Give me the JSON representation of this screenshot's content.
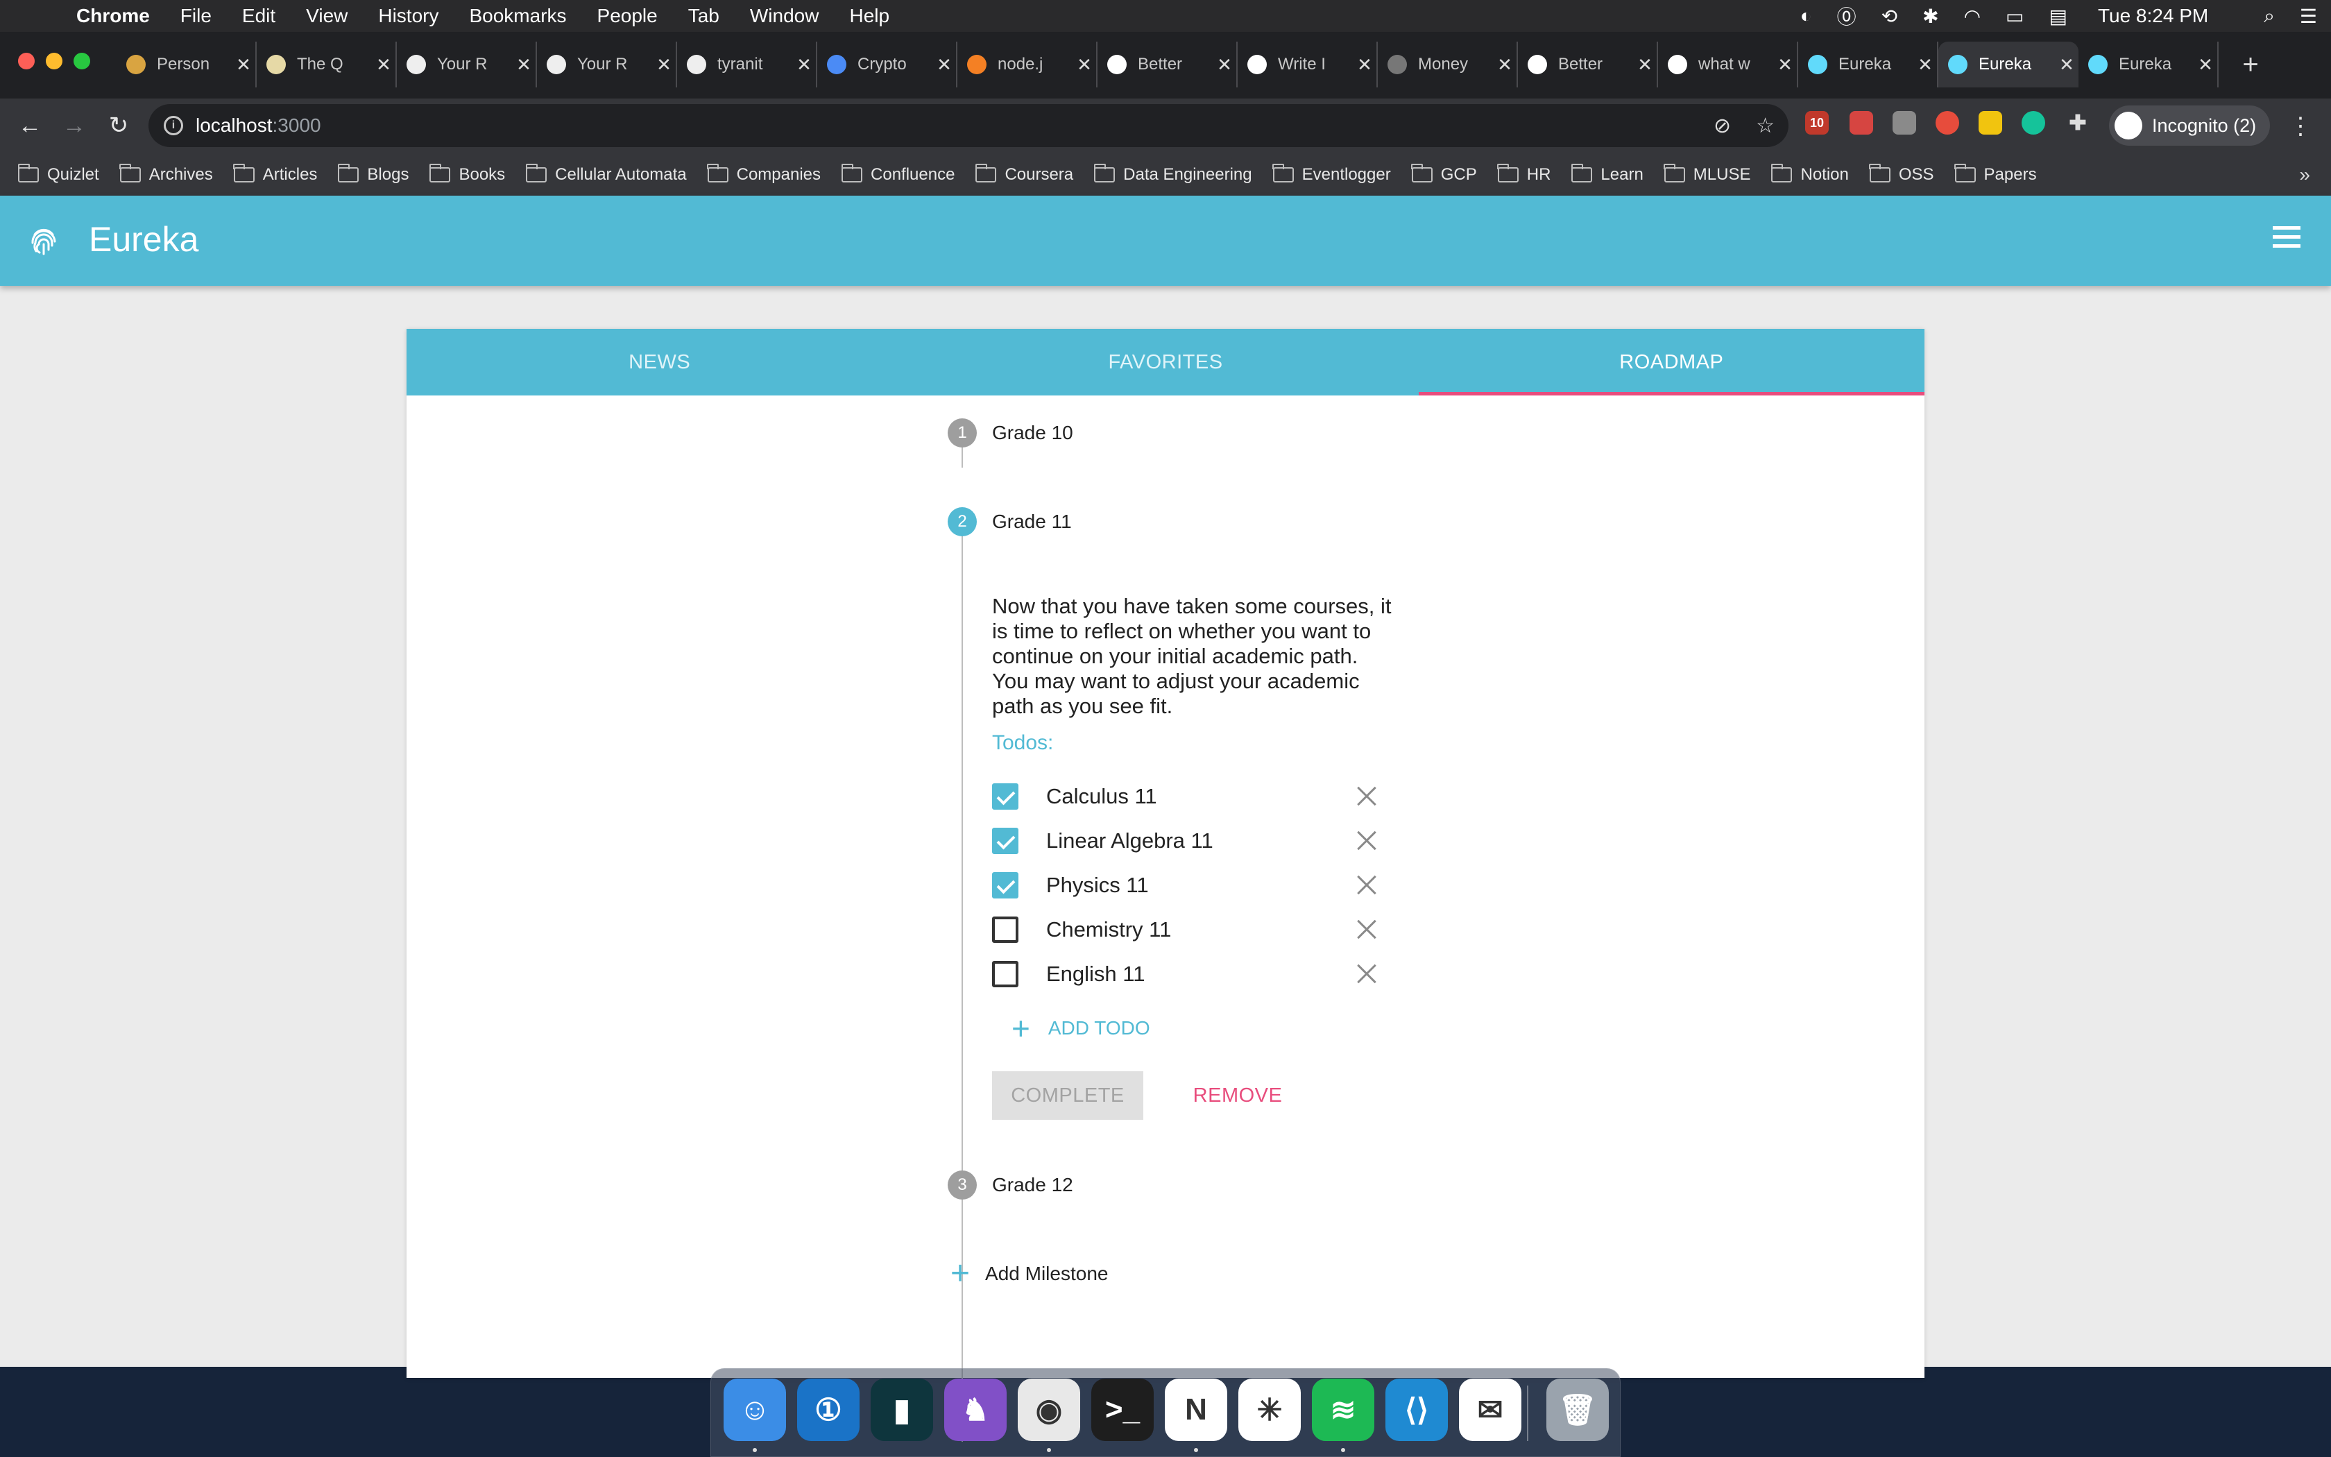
{
  "menubar": {
    "app_name": "Chrome",
    "menus": [
      "File",
      "Edit",
      "View",
      "History",
      "Bookmarks",
      "People",
      "Tab",
      "Window",
      "Help"
    ],
    "clock": "Tue 8:24 PM"
  },
  "browser": {
    "tabs": [
      {
        "title": "Person",
        "icon": "person-favicon",
        "color": "#d9a441"
      },
      {
        "title": "The Q",
        "icon": "note-favicon",
        "color": "#e6d9a6"
      },
      {
        "title": "Your R",
        "icon": "github-favicon",
        "color": "#eeeeee"
      },
      {
        "title": "Your R",
        "icon": "github-favicon",
        "color": "#eeeeee"
      },
      {
        "title": "tyranit",
        "icon": "github-favicon",
        "color": "#eeeeee"
      },
      {
        "title": "Crypto",
        "icon": "infinity-favicon",
        "color": "#4b8bf5"
      },
      {
        "title": "node.j",
        "icon": "stack-favicon",
        "color": "#f48024"
      },
      {
        "title": "Better",
        "icon": "medium-favicon",
        "color": "#ffffff"
      },
      {
        "title": "Write I",
        "icon": "medium-favicon",
        "color": "#ffffff"
      },
      {
        "title": "Money",
        "icon": "globe-favicon",
        "color": "#777777"
      },
      {
        "title": "Better",
        "icon": "medium-favicon",
        "color": "#ffffff"
      },
      {
        "title": "what w",
        "icon": "google-favicon",
        "color": "#ffffff"
      },
      {
        "title": "Eureka",
        "icon": "react-favicon",
        "color": "#61dafb"
      },
      {
        "title": "Eureka",
        "icon": "react-favicon",
        "color": "#61dafb",
        "active": true
      },
      {
        "title": "Eureka",
        "icon": "react-favicon",
        "color": "#61dafb"
      }
    ],
    "url_host": "localhost",
    "url_port": ":3000",
    "profile_label": "Incognito (2)",
    "extension_badge": "10",
    "bookmarks": [
      "Quizlet",
      "Archives",
      "Articles",
      "Blogs",
      "Books",
      "Cellular Automata",
      "Companies",
      "Confluence",
      "Coursera",
      "Data Engineering",
      "Eventlogger",
      "GCP",
      "HR",
      "Learn",
      "MLUSE",
      "Notion",
      "OSS",
      "Papers"
    ]
  },
  "app": {
    "brand": "Eureka",
    "accent": "#52bad4",
    "danger": "#e84d7d",
    "tabs": [
      "NEWS",
      "FAVORITES",
      "ROADMAP"
    ],
    "active_tab": "ROADMAP",
    "milestones": [
      {
        "num": "1",
        "label": "Grade 10"
      },
      {
        "num": "2",
        "label": "Grade 11"
      },
      {
        "num": "3",
        "label": "Grade 12"
      }
    ],
    "active_milestone": {
      "description": "Now that you have taken some courses, it is time to reflect on whether you want to continue on your initial academic path. You may want to adjust your academic path as you see fit.",
      "todos_label": "Todos:",
      "todos": [
        {
          "name": "Calculus 11",
          "done": true
        },
        {
          "name": "Linear Algebra 11",
          "done": true
        },
        {
          "name": "Physics 11",
          "done": true
        },
        {
          "name": "Chemistry 11",
          "done": false
        },
        {
          "name": "English 11",
          "done": false
        }
      ],
      "add_todo_label": "ADD TODO",
      "complete_label": "COMPLETE",
      "remove_label": "REMOVE"
    },
    "add_milestone_label": "Add Milestone"
  },
  "dock": {
    "apps": [
      {
        "name": "finder-icon",
        "color": "#3b8de6"
      },
      {
        "name": "1password-icon",
        "color": "#1a73c7"
      },
      {
        "name": "dashlane-icon",
        "color": "#0e353d"
      },
      {
        "name": "github-desktop-icon",
        "color": "#8150c7"
      },
      {
        "name": "chrome-icon",
        "color": "#e8e8e8"
      },
      {
        "name": "terminal-icon",
        "color": "#1e1e1e"
      },
      {
        "name": "notion-icon",
        "color": "#ffffff"
      },
      {
        "name": "slack-icon",
        "color": "#ffffff"
      },
      {
        "name": "spotify-icon",
        "color": "#1db954"
      },
      {
        "name": "vscode-icon",
        "color": "#1f8ad2"
      },
      {
        "name": "wechat-icon",
        "color": "#ffffff"
      },
      {
        "name": "trash-icon",
        "color": "#9aa3ad"
      }
    ]
  }
}
